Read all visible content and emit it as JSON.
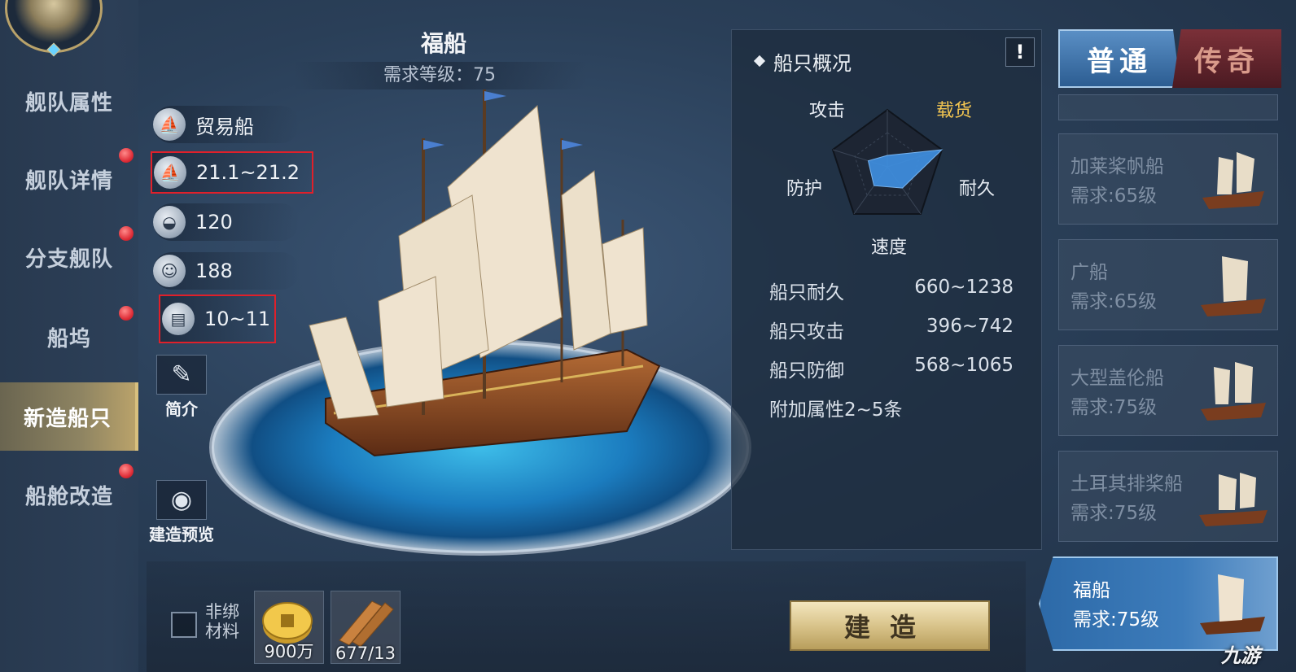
{
  "nav": {
    "items": [
      {
        "label": "舰队属性",
        "dot": false,
        "active": false
      },
      {
        "label": "舰队详情",
        "dot": true,
        "active": false
      },
      {
        "label": "分支舰队",
        "dot": true,
        "active": false
      },
      {
        "label": "船坞",
        "dot": true,
        "active": false
      },
      {
        "label": "新造船只",
        "dot": false,
        "active": true
      },
      {
        "label": "船舱改造",
        "dot": true,
        "active": false
      }
    ]
  },
  "ship": {
    "name": "福船",
    "requirement": "需求等级：75",
    "stats": [
      {
        "icon": "ship-type-icon",
        "value": "贸易船"
      },
      {
        "icon": "sail-speed-icon",
        "value": "21.1~21.2"
      },
      {
        "icon": "bread-supply-icon",
        "value": "120"
      },
      {
        "icon": "sailor-icon",
        "value": "188"
      },
      {
        "icon": "cargo-barrel-icon",
        "value": "10~11"
      }
    ],
    "intro_label": "简介",
    "preview_label": "建造预览"
  },
  "overview": {
    "title": "船只概况",
    "info_glyph": "!",
    "radar": {
      "labels": {
        "top_left": "攻击",
        "top_right": "载货",
        "left": "防护",
        "right": "耐久",
        "bottom": "速度"
      },
      "highlighted": "载货",
      "levels": {
        "攻击": 0.2,
        "载货": 1.0,
        "耐久": 0.45,
        "速度": 0.4,
        "防护": 0.35
      }
    },
    "attributes": [
      {
        "label": "船只耐久",
        "value": "660~1238"
      },
      {
        "label": "船只攻击",
        "value": "396~742"
      },
      {
        "label": "船只防御",
        "value": "568~1065"
      },
      {
        "label": "附加属性2~5条",
        "value": ""
      }
    ]
  },
  "tabs": {
    "normal": "普通",
    "legend": "传奇"
  },
  "ship_list": [
    {
      "name": "加莱桨帆船",
      "req": "需求:65级",
      "active": false
    },
    {
      "name": "广船",
      "req": "需求:65级",
      "active": false
    },
    {
      "name": "大型盖伦船",
      "req": "需求:75级",
      "active": false
    },
    {
      "name": "土耳其排桨船",
      "req": "需求:75级",
      "active": false
    },
    {
      "name": "福船",
      "req": "需求:75级",
      "active": true
    }
  ],
  "bottom": {
    "unbound_label": "非绑材料",
    "materials": [
      {
        "icon": "gold-coin-icon",
        "count": "900万"
      },
      {
        "icon": "wood-plank-icon",
        "count": "677/13"
      }
    ],
    "build_label": "建造"
  },
  "watermark": "九游",
  "colors": {
    "accent_blue": "#3d7cbb",
    "highlight_red": "#e0202a",
    "radar_fill": "#3f8fe0",
    "cargo_gold": "#f4c651"
  }
}
